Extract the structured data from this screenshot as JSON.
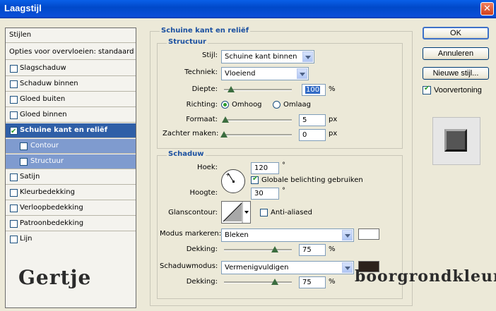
{
  "window": {
    "title": "Laagstijl",
    "close_icon": "close-icon"
  },
  "left_panel": {
    "header": "Stijlen",
    "blend_options": "Opties voor overvloeien: standaard",
    "items": [
      {
        "label": "Slagschaduw",
        "checked": false
      },
      {
        "label": "Schaduw binnen",
        "checked": false
      },
      {
        "label": "Gloed buiten",
        "checked": false
      },
      {
        "label": "Gloed binnen",
        "checked": false
      },
      {
        "label": "Schuine kant en reliëf",
        "checked": true,
        "selected": true
      },
      {
        "label": "Contour",
        "checked": false,
        "sub": true
      },
      {
        "label": "Structuur",
        "checked": false,
        "sub": true
      },
      {
        "label": "Satijn",
        "checked": false
      },
      {
        "label": "Kleurbedekking",
        "checked": false
      },
      {
        "label": "Verloopbedekking",
        "checked": false
      },
      {
        "label": "Patroonbedekking",
        "checked": false
      },
      {
        "label": "Lijn",
        "checked": false
      }
    ]
  },
  "watermarks": {
    "left": "Gertje",
    "right": "boorgrondkleur"
  },
  "bevel": {
    "title": "Schuine kant en reliëf",
    "structure": {
      "title": "Structuur",
      "style_label": "Stijl:",
      "style_value": "Schuine kant binnen",
      "technique_label": "Techniek:",
      "technique_value": "Vloeiend",
      "depth_label": "Diepte:",
      "depth_value": "100",
      "depth_unit": "%",
      "depth_level": 0.1,
      "direction_label": "Richting:",
      "dir_up": "Omhoog",
      "dir_down": "Omlaag",
      "direction_selected": "up",
      "size_label": "Formaat:",
      "size_value": "5",
      "size_unit": "px",
      "size_level": 0.02,
      "soften_label": "Zachter maken:",
      "soften_value": "0",
      "soften_unit": "px",
      "soften_level": 0.0
    },
    "shading": {
      "title": "Schaduw",
      "angle_label": "Hoek:",
      "angle_value": "120",
      "angle_unit": "°",
      "global_light_label": "Globale belichting gebruiken",
      "global_light_checked": true,
      "altitude_label": "Hoogte:",
      "altitude_value": "30",
      "altitude_unit": "°",
      "gloss_label": "Glanscontour:",
      "anti_aliased_label": "Anti-aliased",
      "anti_aliased_checked": false,
      "highlight_mode_label": "Modus markeren:",
      "highlight_mode_value": "Bleken",
      "highlight_color": "#ffffff",
      "highlight_opacity_label": "Dekking:",
      "highlight_opacity_value": "75",
      "highlight_opacity_unit": "%",
      "highlight_opacity_level": 0.75,
      "shadow_mode_label": "Schaduwmodus:",
      "shadow_mode_value": "Vermenigvuldigen",
      "shadow_color": "#2b211b",
      "shadow_opacity_label": "Dekking:",
      "shadow_opacity_value": "75",
      "shadow_opacity_unit": "%",
      "shadow_opacity_level": 0.75
    }
  },
  "buttons": {
    "ok": "OK",
    "cancel": "Annuleren",
    "new_style": "Nieuwe stijl...",
    "preview_label": "Voorvertoning",
    "preview_checked": true
  }
}
